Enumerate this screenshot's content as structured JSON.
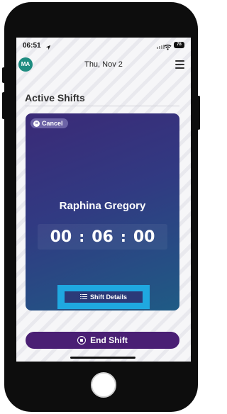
{
  "status_bar": {
    "time": "06:51",
    "battery": "78"
  },
  "header": {
    "avatar_initials": "MA",
    "date": "Thu, Nov 2"
  },
  "section": {
    "title": "Active Shifts"
  },
  "shift_card": {
    "cancel_label": "Cancel",
    "name": "Raphina Gregory",
    "timer": {
      "hours": "00",
      "minutes": "06",
      "seconds": "00",
      "separator": ":"
    },
    "details_label": "Shift Details"
  },
  "end_shift": {
    "label": "End Shift"
  },
  "colors": {
    "card_top": "#3b2a77",
    "card_bottom": "#1f5b85",
    "end_button": "#4a1f74",
    "highlight": "#1fa8e0",
    "avatar": "#1e8c80"
  },
  "icons": {
    "location": "location-arrow-icon",
    "wifi": "wifi-icon",
    "menu": "hamburger-menu-icon",
    "cancel": "close-circle-icon",
    "details": "list-icon",
    "end": "stop-circle-icon"
  }
}
